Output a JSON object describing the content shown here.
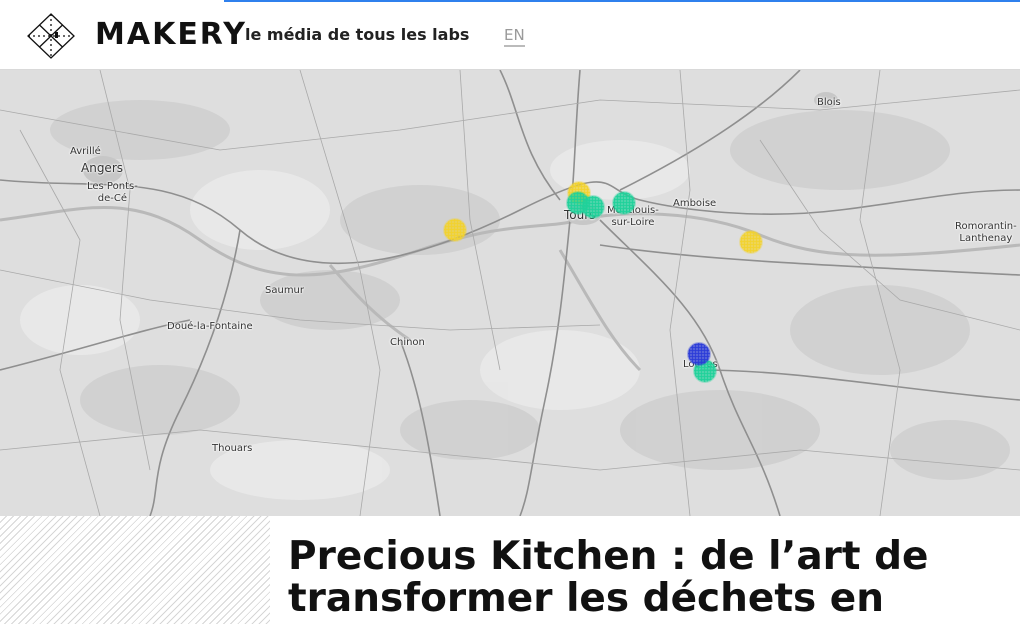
{
  "header": {
    "brand": "MAKERY",
    "tagline": "le média de tous les labs",
    "language_link": "EN"
  },
  "map": {
    "places": [
      {
        "label": "Blois"
      },
      {
        "label": "Avrillé"
      },
      {
        "label": "Angers"
      },
      {
        "label": "Les Ponts-\nde-Cé"
      },
      {
        "label": "Tours"
      },
      {
        "label": "Montlouis-\nsur-Loire"
      },
      {
        "label": "Amboise"
      },
      {
        "label": "Romorantin-\nLanthenay"
      },
      {
        "label": "Saumur"
      },
      {
        "label": "Doué-la-Fontaine"
      },
      {
        "label": "Chinon"
      },
      {
        "label": "Loches"
      },
      {
        "label": "Thouars"
      }
    ],
    "markers": [
      {
        "color": "#f2d22e",
        "kind": "yellow"
      },
      {
        "color": "#f2d22e",
        "kind": "yellow"
      },
      {
        "color": "#f2d22e",
        "kind": "yellow"
      },
      {
        "color": "#1fd19a",
        "kind": "green"
      },
      {
        "color": "#1fd19a",
        "kind": "green"
      },
      {
        "color": "#1fd19a",
        "kind": "green"
      },
      {
        "color": "#1fd19a",
        "kind": "green"
      },
      {
        "color": "#2b3bd8",
        "kind": "blue"
      }
    ]
  },
  "article": {
    "title": "Precious Kitchen : de l’art de transformer les déchets en"
  }
}
